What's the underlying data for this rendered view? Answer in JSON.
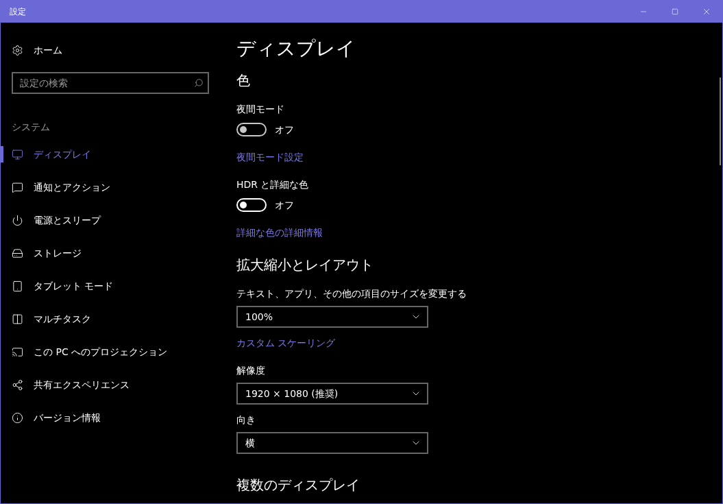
{
  "window": {
    "title": "設定"
  },
  "sidebar": {
    "home": "ホーム",
    "search": {
      "placeholder": "設定の検索"
    },
    "section": "システム",
    "items": [
      {
        "label": "ディスプレイ",
        "selected": true
      },
      {
        "label": "通知とアクション",
        "selected": false
      },
      {
        "label": "電源とスリープ",
        "selected": false
      },
      {
        "label": "ストレージ",
        "selected": false
      },
      {
        "label": "タブレット モード",
        "selected": false
      },
      {
        "label": "マルチタスク",
        "selected": false
      },
      {
        "label": "この PC へのプロジェクション",
        "selected": false
      },
      {
        "label": "共有エクスペリエンス",
        "selected": false
      },
      {
        "label": "バージョン情報",
        "selected": false
      }
    ]
  },
  "content": {
    "title": "ディスプレイ",
    "items": [
      {
        "kind": "heading",
        "text": "色"
      },
      {
        "kind": "label",
        "text": "夜間モード"
      },
      {
        "kind": "toggle",
        "text": "オフ",
        "on": false,
        "disabled": true
      },
      {
        "kind": "link",
        "text": "夜間モード設定"
      },
      {
        "kind": "label",
        "text": "HDR と詳細な色"
      },
      {
        "kind": "toggle",
        "text": "オフ",
        "on": false,
        "disabled": false
      },
      {
        "kind": "link",
        "text": "詳細な色の詳細情報"
      },
      {
        "kind": "heading",
        "text": "拡大縮小とレイアウト"
      },
      {
        "kind": "label",
        "text": "テキスト、アプリ、その他の項目のサイズを変更する"
      },
      {
        "kind": "dropdown",
        "text": "100%"
      },
      {
        "kind": "link",
        "text": "カスタム スケーリング"
      },
      {
        "kind": "label",
        "text": "解像度"
      },
      {
        "kind": "dropdown",
        "text": "1920 × 1080 (推奨)"
      },
      {
        "kind": "label",
        "text": "向き"
      },
      {
        "kind": "dropdown",
        "text": "横"
      },
      {
        "kind": "heading",
        "text": "複数のディスプレイ"
      }
    ]
  }
}
